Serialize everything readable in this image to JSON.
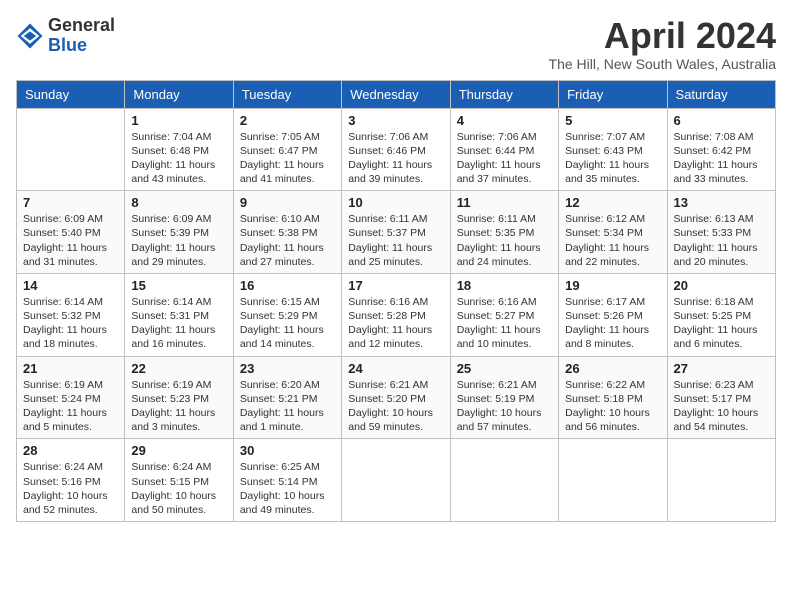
{
  "header": {
    "logo_line1": "General",
    "logo_line2": "Blue",
    "month": "April 2024",
    "location": "The Hill, New South Wales, Australia"
  },
  "weekdays": [
    "Sunday",
    "Monday",
    "Tuesday",
    "Wednesday",
    "Thursday",
    "Friday",
    "Saturday"
  ],
  "weeks": [
    [
      {
        "day": "",
        "info": ""
      },
      {
        "day": "1",
        "info": "Sunrise: 7:04 AM\nSunset: 6:48 PM\nDaylight: 11 hours\nand 43 minutes."
      },
      {
        "day": "2",
        "info": "Sunrise: 7:05 AM\nSunset: 6:47 PM\nDaylight: 11 hours\nand 41 minutes."
      },
      {
        "day": "3",
        "info": "Sunrise: 7:06 AM\nSunset: 6:46 PM\nDaylight: 11 hours\nand 39 minutes."
      },
      {
        "day": "4",
        "info": "Sunrise: 7:06 AM\nSunset: 6:44 PM\nDaylight: 11 hours\nand 37 minutes."
      },
      {
        "day": "5",
        "info": "Sunrise: 7:07 AM\nSunset: 6:43 PM\nDaylight: 11 hours\nand 35 minutes."
      },
      {
        "day": "6",
        "info": "Sunrise: 7:08 AM\nSunset: 6:42 PM\nDaylight: 11 hours\nand 33 minutes."
      }
    ],
    [
      {
        "day": "7",
        "info": "Sunrise: 6:09 AM\nSunset: 5:40 PM\nDaylight: 11 hours\nand 31 minutes."
      },
      {
        "day": "8",
        "info": "Sunrise: 6:09 AM\nSunset: 5:39 PM\nDaylight: 11 hours\nand 29 minutes."
      },
      {
        "day": "9",
        "info": "Sunrise: 6:10 AM\nSunset: 5:38 PM\nDaylight: 11 hours\nand 27 minutes."
      },
      {
        "day": "10",
        "info": "Sunrise: 6:11 AM\nSunset: 5:37 PM\nDaylight: 11 hours\nand 25 minutes."
      },
      {
        "day": "11",
        "info": "Sunrise: 6:11 AM\nSunset: 5:35 PM\nDaylight: 11 hours\nand 24 minutes."
      },
      {
        "day": "12",
        "info": "Sunrise: 6:12 AM\nSunset: 5:34 PM\nDaylight: 11 hours\nand 22 minutes."
      },
      {
        "day": "13",
        "info": "Sunrise: 6:13 AM\nSunset: 5:33 PM\nDaylight: 11 hours\nand 20 minutes."
      }
    ],
    [
      {
        "day": "14",
        "info": "Sunrise: 6:14 AM\nSunset: 5:32 PM\nDaylight: 11 hours\nand 18 minutes."
      },
      {
        "day": "15",
        "info": "Sunrise: 6:14 AM\nSunset: 5:31 PM\nDaylight: 11 hours\nand 16 minutes."
      },
      {
        "day": "16",
        "info": "Sunrise: 6:15 AM\nSunset: 5:29 PM\nDaylight: 11 hours\nand 14 minutes."
      },
      {
        "day": "17",
        "info": "Sunrise: 6:16 AM\nSunset: 5:28 PM\nDaylight: 11 hours\nand 12 minutes."
      },
      {
        "day": "18",
        "info": "Sunrise: 6:16 AM\nSunset: 5:27 PM\nDaylight: 11 hours\nand 10 minutes."
      },
      {
        "day": "19",
        "info": "Sunrise: 6:17 AM\nSunset: 5:26 PM\nDaylight: 11 hours\nand 8 minutes."
      },
      {
        "day": "20",
        "info": "Sunrise: 6:18 AM\nSunset: 5:25 PM\nDaylight: 11 hours\nand 6 minutes."
      }
    ],
    [
      {
        "day": "21",
        "info": "Sunrise: 6:19 AM\nSunset: 5:24 PM\nDaylight: 11 hours\nand 5 minutes."
      },
      {
        "day": "22",
        "info": "Sunrise: 6:19 AM\nSunset: 5:23 PM\nDaylight: 11 hours\nand 3 minutes."
      },
      {
        "day": "23",
        "info": "Sunrise: 6:20 AM\nSunset: 5:21 PM\nDaylight: 11 hours\nand 1 minute."
      },
      {
        "day": "24",
        "info": "Sunrise: 6:21 AM\nSunset: 5:20 PM\nDaylight: 10 hours\nand 59 minutes."
      },
      {
        "day": "25",
        "info": "Sunrise: 6:21 AM\nSunset: 5:19 PM\nDaylight: 10 hours\nand 57 minutes."
      },
      {
        "day": "26",
        "info": "Sunrise: 6:22 AM\nSunset: 5:18 PM\nDaylight: 10 hours\nand 56 minutes."
      },
      {
        "day": "27",
        "info": "Sunrise: 6:23 AM\nSunset: 5:17 PM\nDaylight: 10 hours\nand 54 minutes."
      }
    ],
    [
      {
        "day": "28",
        "info": "Sunrise: 6:24 AM\nSunset: 5:16 PM\nDaylight: 10 hours\nand 52 minutes."
      },
      {
        "day": "29",
        "info": "Sunrise: 6:24 AM\nSunset: 5:15 PM\nDaylight: 10 hours\nand 50 minutes."
      },
      {
        "day": "30",
        "info": "Sunrise: 6:25 AM\nSunset: 5:14 PM\nDaylight: 10 hours\nand 49 minutes."
      },
      {
        "day": "",
        "info": ""
      },
      {
        "day": "",
        "info": ""
      },
      {
        "day": "",
        "info": ""
      },
      {
        "day": "",
        "info": ""
      }
    ]
  ]
}
